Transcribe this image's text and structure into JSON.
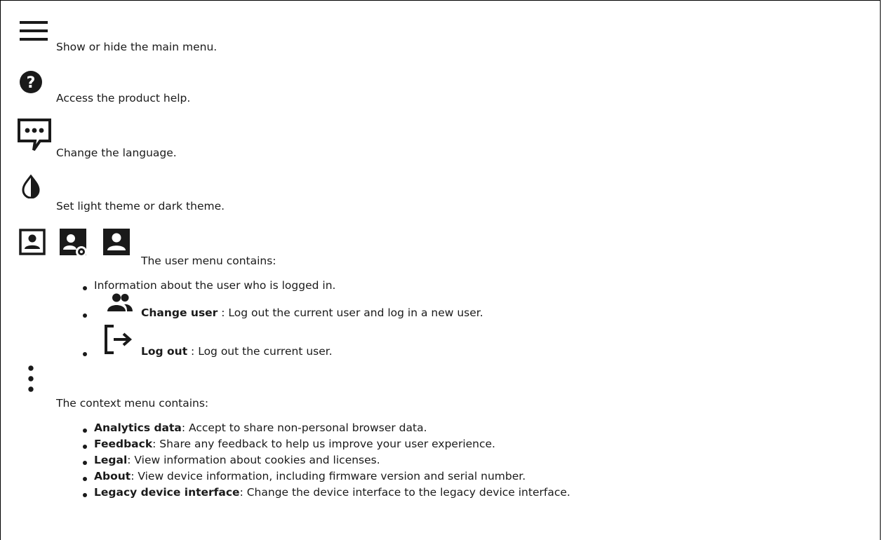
{
  "entries": {
    "menu": "Show or hide the main menu.",
    "help": "Access the product help.",
    "language": "Change the language.",
    "theme": "Set light theme or dark theme.",
    "user_menu": "The user menu contains:",
    "context_menu": "The context menu contains:"
  },
  "user_menu_items": {
    "info": "Information about the user who is logged in.",
    "change_user_label": "Change user",
    "change_user_text": " : Log out the current user and log in a new user.",
    "logout_label": "Log out",
    "logout_text": " : Log out the current user."
  },
  "context_menu_items": [
    {
      "label": "Analytics data",
      "text": ": Accept to share non-personal browser data."
    },
    {
      "label": "Feedback",
      "text": ": Share any feedback to help us improve your user experience."
    },
    {
      "label": "Legal",
      "text": ": View information about cookies and licenses."
    },
    {
      "label": "About",
      "text": ": View device information, including firmware version and serial number."
    },
    {
      "label": "Legacy device interface",
      "text": ": Change the device interface to the legacy device interface."
    }
  ],
  "icons": [
    "menu-icon",
    "help-icon",
    "language-icon",
    "theme-icon",
    "user-icon",
    "user-settings-icon",
    "user-filled-icon",
    "change-user-icon",
    "logout-icon",
    "more-vertical-icon"
  ]
}
